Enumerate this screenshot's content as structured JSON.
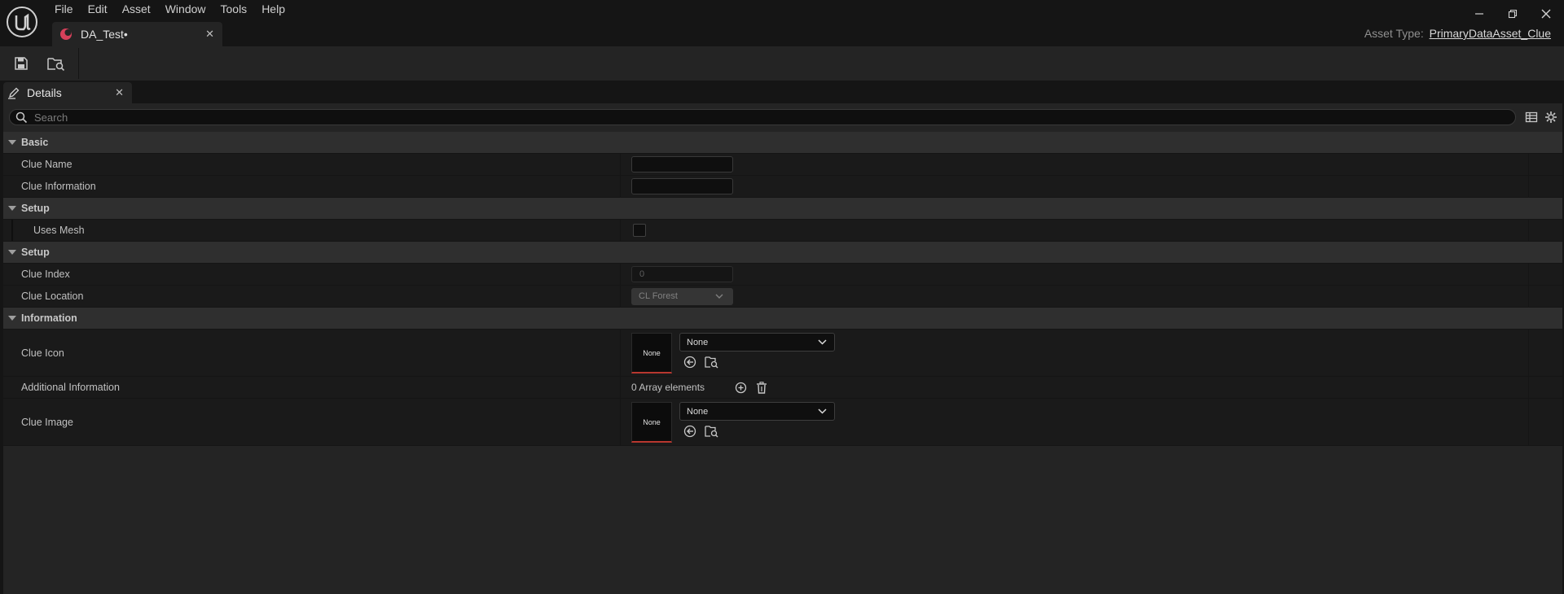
{
  "menu": [
    "File",
    "Edit",
    "Asset",
    "Window",
    "Tools",
    "Help"
  ],
  "document_tab": {
    "label": "DA_Test•"
  },
  "asset_type": {
    "label": "Asset Type:",
    "value": "PrimaryDataAsset_Clue"
  },
  "panel_tab": {
    "label": "Details"
  },
  "search": {
    "placeholder": "Search"
  },
  "categories": {
    "basic": "Basic",
    "setup1": "Setup",
    "setup2": "Setup",
    "information": "Information"
  },
  "properties": {
    "clue_name": {
      "label": "Clue Name",
      "value": ""
    },
    "clue_information": {
      "label": "Clue Information",
      "value": ""
    },
    "uses_mesh": {
      "label": "Uses Mesh",
      "checked": false
    },
    "clue_index": {
      "label": "Clue Index",
      "value": "0"
    },
    "clue_location": {
      "label": "Clue Location",
      "value": "CL Forest"
    },
    "clue_icon": {
      "label": "Clue Icon",
      "thumb": "None",
      "asset": "None"
    },
    "additional_information": {
      "label": "Additional Information",
      "value": "0 Array elements"
    },
    "clue_image": {
      "label": "Clue Image",
      "thumb": "None",
      "asset": "None"
    }
  },
  "colors": {
    "accent_red": "#b8372f",
    "tab_icon": "#d6405a"
  }
}
